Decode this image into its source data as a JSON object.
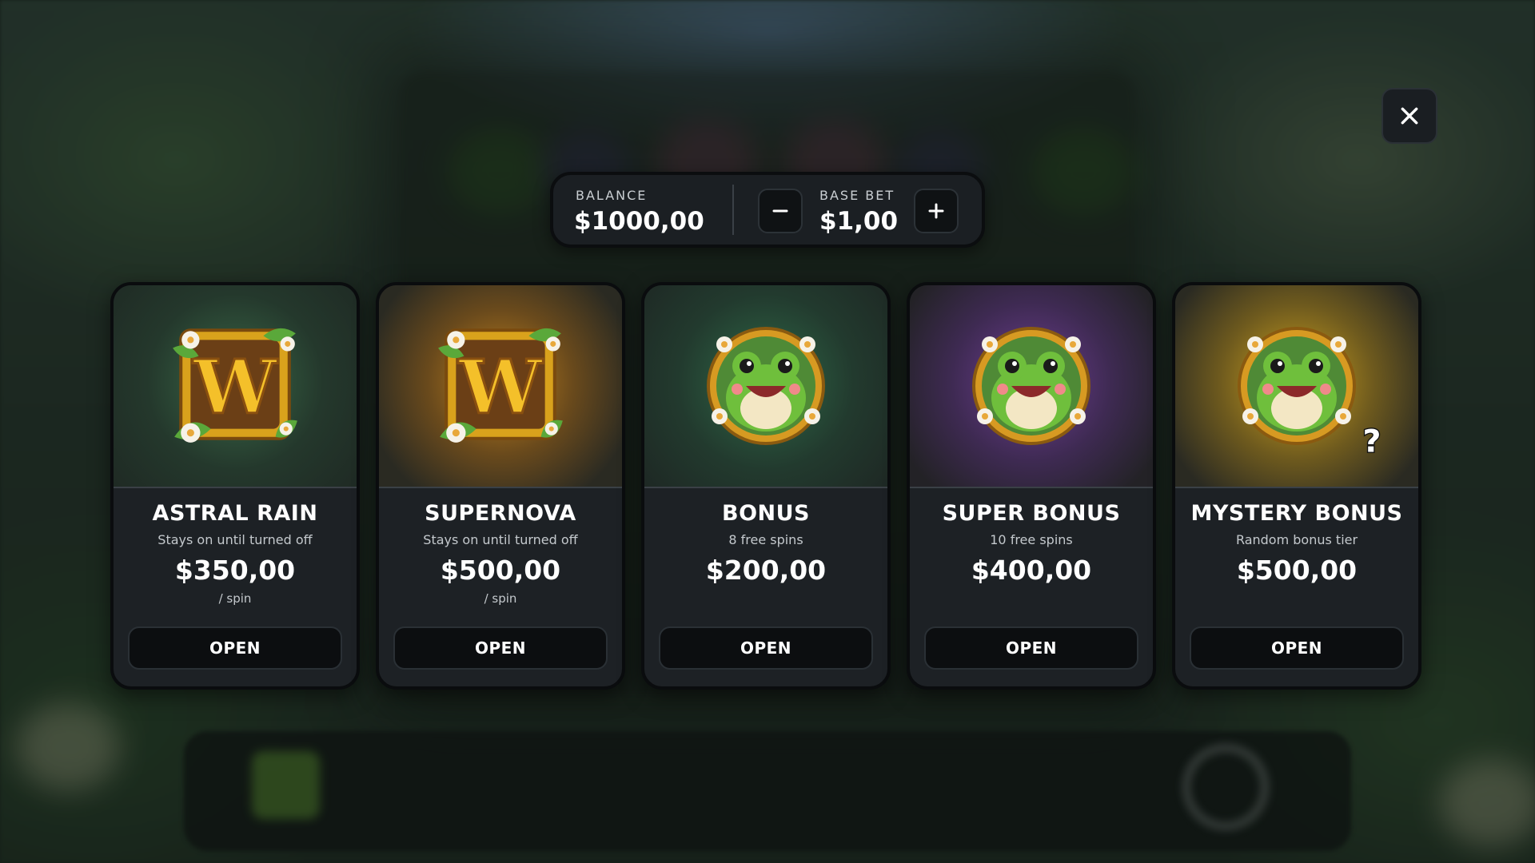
{
  "balance": {
    "label": "BALANCE",
    "value": "$1000,00"
  },
  "base_bet": {
    "label": "BASE BET",
    "value": "$1,00"
  },
  "cards": [
    {
      "title": "ASTRAL RAIN",
      "subtitle": "Stays on until turned off",
      "price": "$350,00",
      "unit": "/ spin",
      "button": "OPEN",
      "icon": "wild-w-icon",
      "glow": "#2e5a3c"
    },
    {
      "title": "SUPERNOVA",
      "subtitle": "Stays on until turned off",
      "price": "$500,00",
      "unit": "/ spin",
      "button": "OPEN",
      "icon": "wild-w-icon",
      "glow": "#b9761a"
    },
    {
      "title": "BONUS",
      "subtitle": "8 free spins",
      "price": "$200,00",
      "unit": "",
      "button": "OPEN",
      "icon": "frog-icon",
      "glow": "#2b5a40"
    },
    {
      "title": "SUPER BONUS",
      "subtitle": "10 free spins",
      "price": "$400,00",
      "unit": "",
      "button": "OPEN",
      "icon": "frog-icon",
      "glow": "#6a3a8c"
    },
    {
      "title": "MYSTERY BONUS",
      "subtitle": "Random bonus tier",
      "price": "$500,00",
      "unit": "",
      "button": "OPEN",
      "icon": "mystery-frog-icon",
      "glow": "#c99a1c"
    }
  ],
  "mystery_mark": "?",
  "colors": {
    "panel": "#1d2125",
    "button": "#0c0e10",
    "text": "#ffffff",
    "subtext": "#c4c9cd"
  }
}
